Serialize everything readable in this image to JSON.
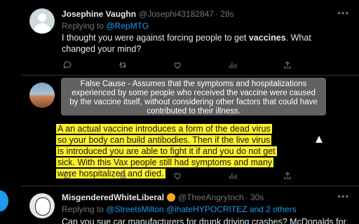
{
  "tweet1": {
    "display_name": "Josephine Vaughn",
    "handle": "@Josephi43182847",
    "time": "· 28s",
    "replying_prefix": "Replying to ",
    "replying_to": "@RepMTG",
    "text_part1": "I thought you were against forcing people to get ",
    "text_bold": "vaccines",
    "text_part2": ". What changed your mind?",
    "more_icon": "•••"
  },
  "tooltip": {
    "text": "False Cause - Assumes that the symptoms and hospitalizations experienced by some people who received the vaccine were caused by the vaccine itself, without considering other factors that could have contributed to their illness."
  },
  "tweet2": {
    "highlight_text": "A an actual vaccine introduces a form of the dead virus so your body can build antibodies. Then if the live virus is introduced you are able to fight it if and you do not get sick. With this Vax people still had symptoms and many were hospitalized and died."
  },
  "tweet3": {
    "display_name": "MisgenderedWhiteLiberal",
    "handle": "@TheeAngryInch",
    "time": "· 30s",
    "replying_prefix": "Replying to ",
    "replying_to_1": "@StreetsMilton",
    "replying_to_2": "@ihateHYPOCRITEZ",
    "replying_and": "and 2 others",
    "text": "Can you sue car manufacturers for drunk driving crashes? McDonalds for"
  },
  "icons": {
    "reply": "reply-icon",
    "retweet": "retweet-icon",
    "like": "heart-icon",
    "views": "views-icon",
    "share": "share-icon"
  },
  "colors": {
    "accent": "#1d9bf0",
    "highlight": "#fff12b",
    "background": "#000000"
  }
}
